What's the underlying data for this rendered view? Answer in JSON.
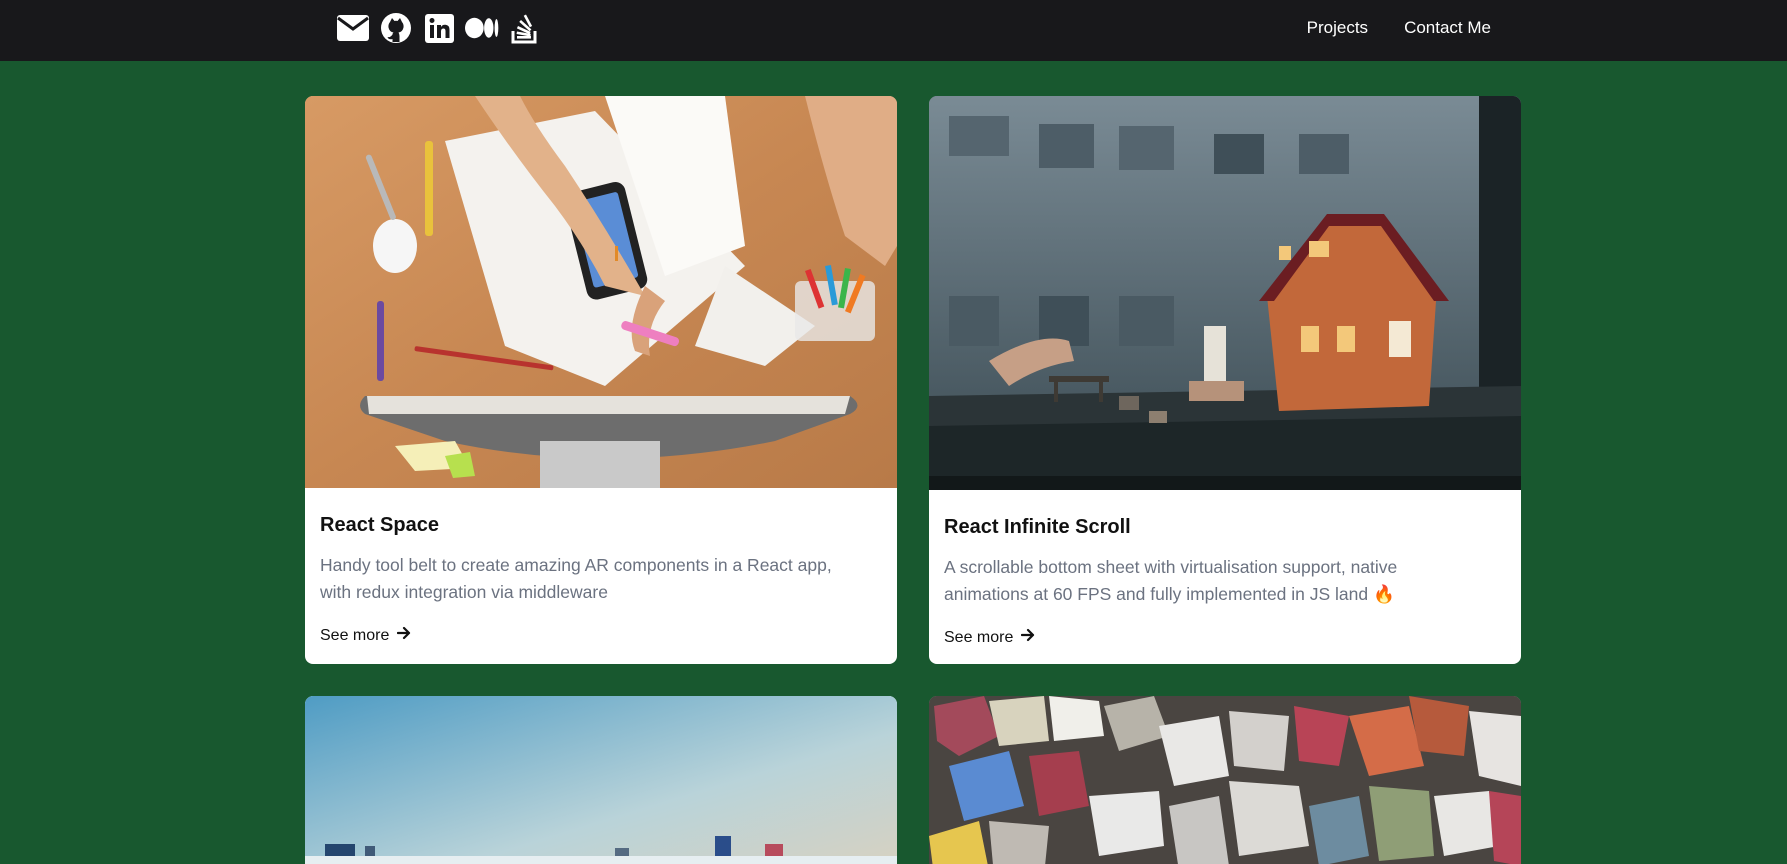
{
  "nav": {
    "icons": [
      "envelope-icon",
      "github-icon",
      "linkedin-icon",
      "medium-icon",
      "stackoverflow-icon"
    ],
    "links": [
      "Projects",
      "Contact Me"
    ]
  },
  "cards": [
    {
      "title": "React Space",
      "description": "Handy tool belt to create amazing AR components in a React app, with redux integration via middleware",
      "link": "See more"
    },
    {
      "title": "React Infinite Scroll",
      "description": "A scrollable bottom sheet with virtualisation support, native animations at 60 FPS and fully implemented in JS land 🔥",
      "link": "See more"
    }
  ],
  "colors": {
    "page_background": "#18582f",
    "navbar": "#18181b",
    "card": "#ffffff",
    "description_text": "#6b7280"
  }
}
